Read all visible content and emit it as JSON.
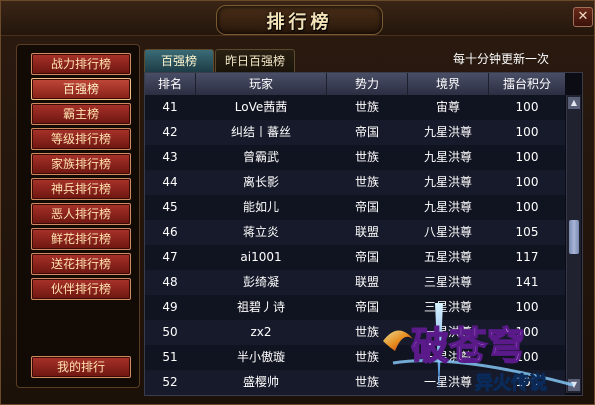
{
  "window": {
    "title": "排行榜"
  },
  "sidebar": {
    "items": [
      {
        "label": "战力排行榜",
        "active": false
      },
      {
        "label": "百强榜",
        "active": true
      },
      {
        "label": "霸主榜",
        "active": false
      },
      {
        "label": "等级排行榜",
        "active": false
      },
      {
        "label": "家族排行榜",
        "active": false
      },
      {
        "label": "神兵排行榜",
        "active": false
      },
      {
        "label": "恶人排行榜",
        "active": false
      },
      {
        "label": "鲜花排行榜",
        "active": false
      },
      {
        "label": "送花排行榜",
        "active": false
      },
      {
        "label": "伙伴排行榜",
        "active": false
      }
    ],
    "my_rank_label": "我的排行"
  },
  "tabs": [
    {
      "label": "百强榜",
      "active": true
    },
    {
      "label": "昨日百强榜",
      "active": false
    }
  ],
  "update_note": "每十分钟更新一次",
  "table": {
    "headers": [
      "排名",
      "玩家",
      "势力",
      "境界",
      "擂台积分"
    ],
    "rows": [
      [
        "41",
        "LoVe茜茜",
        "世族",
        "宙尊",
        "100"
      ],
      [
        "42",
        "纠结丨蕃丝",
        "帝国",
        "九星洪尊",
        "100"
      ],
      [
        "43",
        "曾霸武",
        "世族",
        "九星洪尊",
        "100"
      ],
      [
        "44",
        "离长影",
        "世族",
        "九星洪尊",
        "100"
      ],
      [
        "45",
        "能如儿",
        "帝国",
        "九星洪尊",
        "100"
      ],
      [
        "46",
        "蒋立炎",
        "联盟",
        "八星洪尊",
        "105"
      ],
      [
        "47",
        "ai1001",
        "帝国",
        "五星洪尊",
        "117"
      ],
      [
        "48",
        "彭绮凝",
        "联盟",
        "三星洪尊",
        "141"
      ],
      [
        "49",
        "祖碧丿诗",
        "帝国",
        "三星洪尊",
        "100"
      ],
      [
        "50",
        "zx2",
        "世族",
        "一星洪尊",
        "100"
      ],
      [
        "51",
        "半小傲璇",
        "世族",
        "一星洪尊",
        "100"
      ],
      [
        "52",
        "盛樱帅",
        "世族",
        "一星洪尊",
        "100"
      ]
    ]
  },
  "watermark": {
    "title": "破苍穹",
    "subtitle": "异火传说"
  },
  "colors": {
    "button_red": "#a8322a",
    "tab_active": "#3a6b76",
    "header_bg": "#4a4e66",
    "text": "#ffffff"
  }
}
